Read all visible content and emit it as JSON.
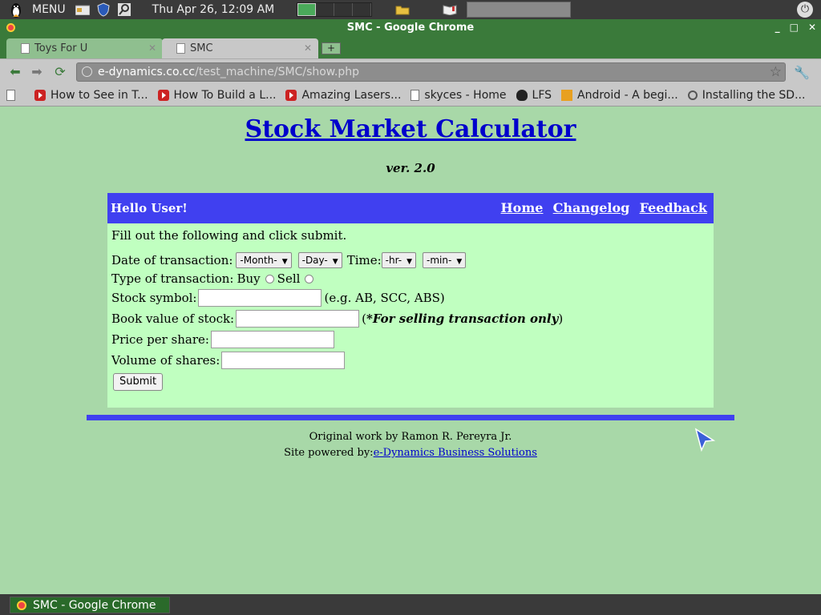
{
  "system_panel": {
    "menu_label": "MENU",
    "clock": "Thu Apr 26, 12:09 AM"
  },
  "window": {
    "title": "SMC - Google Chrome",
    "controls": [
      "_",
      "□",
      "✕"
    ]
  },
  "tabs": [
    {
      "label": "Toys For U",
      "active": false
    },
    {
      "label": "SMC",
      "active": true
    }
  ],
  "address_bar": {
    "domain": "e-dynamics.co.cc",
    "path": "/test_machine/SMC/show.php"
  },
  "bookmarks": [
    {
      "label": "How to See in T...",
      "icon": "youtube-icon"
    },
    {
      "label": "How To Build a L...",
      "icon": "youtube-icon"
    },
    {
      "label": "Amazing Lasers...",
      "icon": "youtube-icon"
    },
    {
      "label": "skyces - Home",
      "icon": "page-icon"
    },
    {
      "label": "LFS",
      "icon": "penguin-icon"
    },
    {
      "label": "Android - A begi...",
      "icon": "android-icon"
    },
    {
      "label": "Installing the SD...",
      "icon": "page-icon"
    }
  ],
  "page": {
    "title": "Stock Market Calculator",
    "version": "ver. 2.0",
    "greeting": "Hello User!",
    "nav": {
      "home": "Home",
      "changelog": "Changelog",
      "feedback": "Feedback"
    },
    "instructions": "Fill out the following and click submit.",
    "form": {
      "date_label": "Date of transaction:",
      "month_select": "-Month-",
      "day_select": "-Day-",
      "time_label": "Time:",
      "hour_select": "-hr-",
      "minute_select": "-min-",
      "type_label": "Type of transaction:",
      "buy_label": "Buy",
      "sell_label": "Sell",
      "symbol_label": "Stock symbol:",
      "symbol_hint": "(e.g. AB, SCC, ABS)",
      "book_value_label": "Book value of stock:",
      "book_value_hint_open": "(",
      "book_value_hint": "*For selling transaction only",
      "book_value_hint_close": ")",
      "price_label": "Price per share:",
      "volume_label": "Volume of shares:",
      "submit_label": "Submit"
    },
    "footer": {
      "credit": "Original work by Ramon R. Pereyra Jr.",
      "powered_prefix": "Site powered by:",
      "powered_link": "e-Dynamics Business Solutions"
    }
  },
  "taskbar": {
    "item_label": "SMC - Google Chrome"
  }
}
